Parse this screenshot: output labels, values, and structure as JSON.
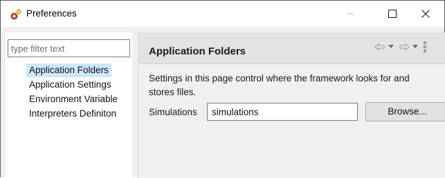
{
  "window": {
    "title": "Preferences",
    "controls": {
      "minimize": "minimize",
      "maximize": "maximize",
      "close": "close"
    }
  },
  "sidebar": {
    "filter_placeholder": "type filter text",
    "items": [
      {
        "label": "Application Folders",
        "selected": true
      },
      {
        "label": "Application Settings",
        "selected": false
      },
      {
        "label": "Environment Variable",
        "selected": false
      },
      {
        "label": "Interpreters Definiton",
        "selected": false
      }
    ]
  },
  "page": {
    "title": "Application Folders",
    "description_line1": "Settings in this page control where the framework looks for and",
    "description_line2": "stores files.",
    "field_label": "Simulations",
    "field_value": "simulations",
    "browse_label": "Browse..."
  },
  "colors": {
    "selection": "#cce8ff",
    "header_bg": "#e3e3e3",
    "app_icon": "#e67e22"
  },
  "icons": [
    "preferences-app-icon",
    "minimize-icon",
    "maximize-icon",
    "close-icon",
    "back-arrow-icon",
    "back-menu-icon",
    "forward-arrow-icon",
    "forward-menu-icon",
    "view-menu-icon"
  ]
}
